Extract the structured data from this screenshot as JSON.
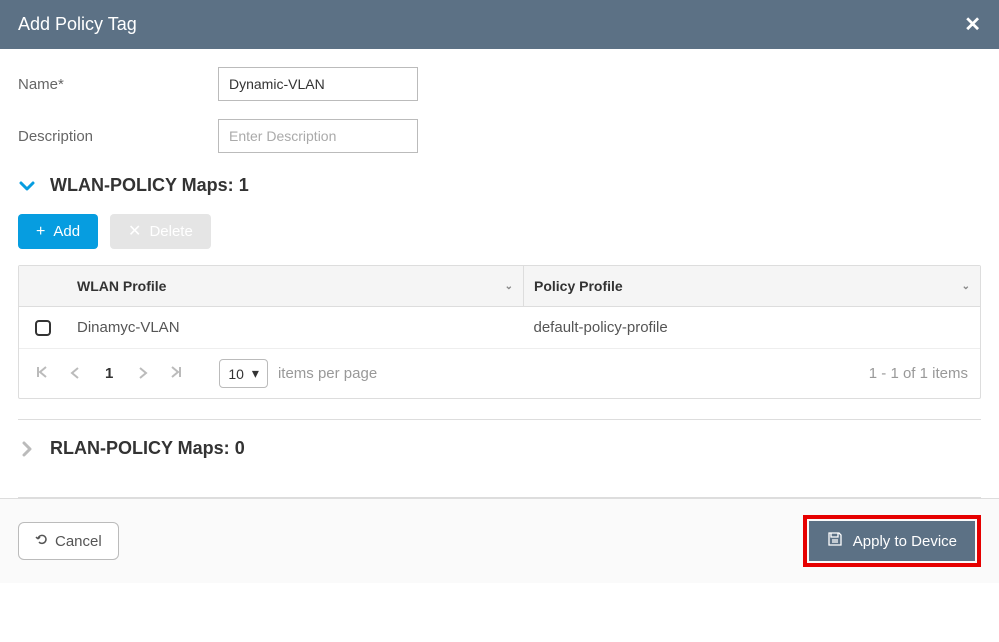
{
  "header": {
    "title": "Add Policy Tag"
  },
  "form": {
    "name_label": "Name*",
    "name_value": "Dynamic-VLAN",
    "description_label": "Description",
    "description_placeholder": "Enter Description"
  },
  "wlan_section": {
    "title": "WLAN-POLICY Maps:",
    "count": "1"
  },
  "buttons": {
    "add": "Add",
    "delete": "Delete"
  },
  "table": {
    "columns": {
      "wlan_profile": "WLAN Profile",
      "policy_profile": "Policy Profile"
    },
    "rows": [
      {
        "wlan_profile": "Dinamyc-VLAN",
        "policy_profile": "default-policy-profile"
      }
    ]
  },
  "pager": {
    "current": "1",
    "page_size": "10",
    "items_per_page": "items per page",
    "info": "1 - 1 of 1 items"
  },
  "rlan_section": {
    "title": "RLAN-POLICY Maps:",
    "count": "0"
  },
  "footer": {
    "cancel": "Cancel",
    "apply": "Apply to Device"
  }
}
